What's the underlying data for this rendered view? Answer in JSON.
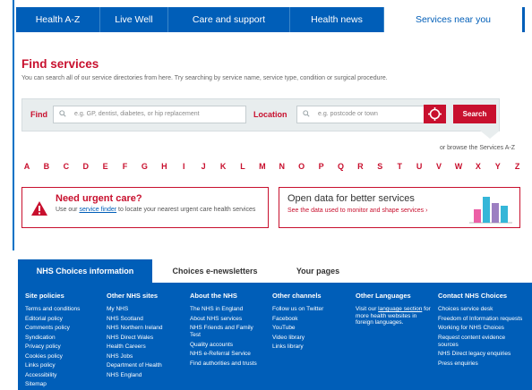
{
  "topnav": {
    "items": [
      {
        "label": "Health A-Z"
      },
      {
        "label": "Live Well"
      },
      {
        "label": "Care and support"
      },
      {
        "label": "Health news"
      },
      {
        "label": "Services near you"
      }
    ],
    "active_index": 4
  },
  "find": {
    "title": "Find services",
    "description": "You can search all of our service directories from here. Try searching by service name, service type, condition or surgical procedure.",
    "find_label": "Find",
    "find_placeholder": "e.g. GP, dentist, diabetes, or hip replacement",
    "location_label": "Location",
    "location_placeholder": "e.g. postcode or town",
    "search_label": "Search",
    "browse_text": "or browse the Services A-Z"
  },
  "az": [
    "A",
    "B",
    "C",
    "D",
    "E",
    "F",
    "G",
    "H",
    "I",
    "J",
    "K",
    "L",
    "M",
    "N",
    "O",
    "P",
    "Q",
    "R",
    "S",
    "T",
    "U",
    "V",
    "W",
    "X",
    "Y",
    "Z"
  ],
  "urgent": {
    "title": "Need urgent care?",
    "text_before": "Use our ",
    "link": "service finder",
    "text_after": " to locate your nearest urgent care health services"
  },
  "opendata": {
    "title": "Open data for better services",
    "link": "See the data used to monitor and shape services ›",
    "bar_colors": [
      "#ec5fa6",
      "#35b6d8",
      "#9c7fc2",
      "#35b6d8"
    ]
  },
  "footer": {
    "tabs": [
      {
        "label": "NHS Choices information"
      },
      {
        "label": "Choices e-newsletters"
      },
      {
        "label": "Your pages"
      }
    ],
    "columns": [
      {
        "title": "Site policies",
        "links": [
          "Terms and conditions",
          "Editorial policy",
          "Comments policy",
          "Syndication",
          "Privacy policy",
          "Cookies policy",
          "Links policy",
          "Accessibility",
          "Sitemap"
        ]
      },
      {
        "title": "Other NHS sites",
        "links": [
          "My NHS",
          "NHS Scotland",
          "NHS Northern Ireland",
          "NHS Direct Wales",
          "Health Careers",
          "NHS Jobs",
          "Department of Health",
          "NHS England"
        ]
      },
      {
        "title": "About the NHS",
        "links": [
          "The NHS in England",
          "About NHS services",
          "NHS Friends and Family Test",
          "Quality accounts",
          "NHS e-Referral Service",
          "Find authorities and trusts"
        ]
      },
      {
        "title": "Other channels",
        "links": [
          "Follow us on Twitter",
          "Facebook",
          "YouTube",
          "Video library",
          "Links library"
        ]
      },
      {
        "title": "Other Languages",
        "note_before": "Visit our ",
        "note_link": "language section",
        "note_after": " for more health websites in foreign languages."
      },
      {
        "title": "Contact NHS Choices",
        "links": [
          "Choices service desk",
          "Freedom of Information requests",
          "Working for NHS Choices",
          "Request content evidence sources",
          "NHS Direct legacy enquiries",
          "Press enquiries"
        ]
      }
    ]
  },
  "colors": {
    "nhs_blue": "#005eb8",
    "nhs_red": "#c8102e",
    "panel_grey": "#e8edee"
  }
}
